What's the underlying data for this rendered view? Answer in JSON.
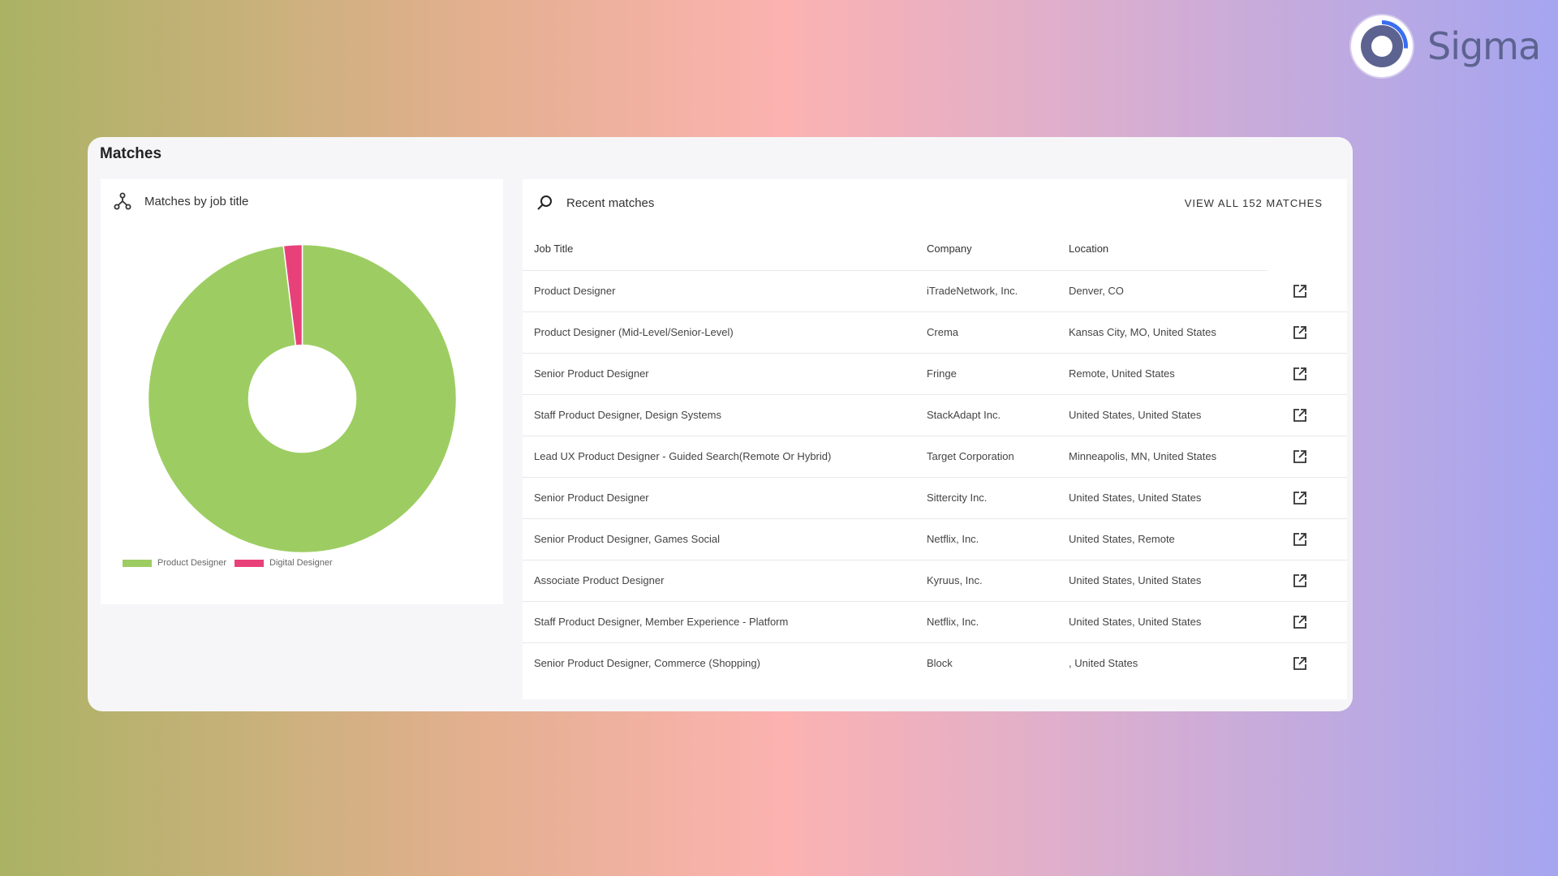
{
  "brand": {
    "name": "Sigma"
  },
  "card": {
    "title": "Matches"
  },
  "chart_panel": {
    "title": "Matches by job title",
    "icon": "hierarchy-icon"
  },
  "chart_data": {
    "type": "pie",
    "donut": true,
    "categories": [
      "Product Designer",
      "Digital Designer"
    ],
    "values": [
      151,
      3
    ],
    "colors": [
      "#9dcd62",
      "#e8417a"
    ],
    "legend": {
      "position": "bottom-left",
      "items": [
        "Product Designer",
        "Digital Designer"
      ]
    }
  },
  "table_panel": {
    "title": "Recent matches",
    "icon": "search-icon",
    "view_all": "VIEW ALL 152 MATCHES",
    "columns": [
      "Job Title",
      "Company",
      "Location"
    ],
    "rows": [
      {
        "title": "Product Designer",
        "company": "iTradeNetwork, Inc.",
        "location": "Denver, CO"
      },
      {
        "title": "Product Designer (Mid-Level/Senior-Level)",
        "company": "Crema",
        "location": "Kansas City, MO, United States"
      },
      {
        "title": "Senior Product Designer",
        "company": "Fringe",
        "location": "Remote, United States"
      },
      {
        "title": "Staff Product Designer, Design Systems",
        "company": "StackAdapt Inc.",
        "location": "United States, United States"
      },
      {
        "title": "Lead UX Product Designer - Guided Search(Remote Or Hybrid)",
        "company": "Target Corporation",
        "location": "Minneapolis, MN, United States"
      },
      {
        "title": "Senior Product Designer",
        "company": "Sittercity Inc.",
        "location": "United States, United States"
      },
      {
        "title": "Senior Product Designer, Games Social",
        "company": "Netflix, Inc.",
        "location": "United States, Remote"
      },
      {
        "title": "Associate Product Designer",
        "company": "Kyruus, Inc.",
        "location": "United States, United States"
      },
      {
        "title": "Staff Product Designer, Member Experience - Platform",
        "company": "Netflix, Inc.",
        "location": "United States, United States"
      },
      {
        "title": "Senior Product Designer, Commerce (Shopping)",
        "company": "Block",
        "location": ", United States"
      }
    ]
  }
}
